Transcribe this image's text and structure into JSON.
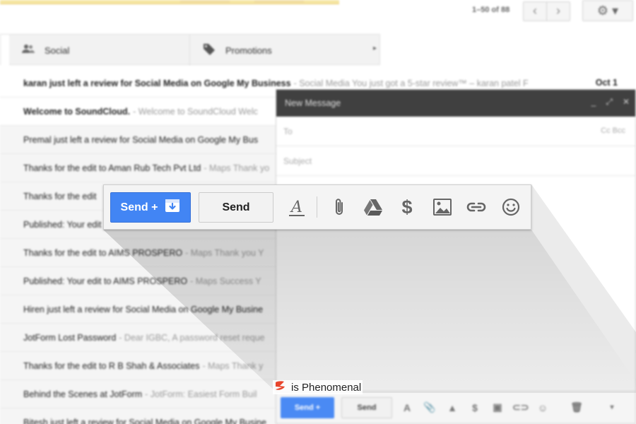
{
  "pager": {
    "text": "1–50 of 88",
    "prev": "‹",
    "next": "›",
    "settings": "⚙ ▾"
  },
  "tabs": [
    {
      "label": "Social",
      "icon": "people-icon"
    },
    {
      "label": "Promotions",
      "icon": "tag-icon"
    }
  ],
  "tabs_more": "▸",
  "emails": [
    {
      "subject": "karan just left a review for Social Media on Google My Business",
      "snippet": "- Social Media You just got a 5-star review™ – karan patel F",
      "date": "Oct 1",
      "unread": true
    },
    {
      "subject": "Welcome to SoundCloud.",
      "snippet": "- Welcome to SoundCloud Welc",
      "date": "",
      "unread": true
    },
    {
      "subject": "Premal just left a review for Social Media on Google My Bus",
      "snippet": "",
      "date": "",
      "unread": false
    },
    {
      "subject": "Thanks for the edit to Aman Rub Tech Pvt Ltd",
      "snippet": "- Maps Thank yo",
      "date": "",
      "unread": false
    },
    {
      "subject": "Thanks for the edit",
      "snippet": "",
      "date": "",
      "unread": false
    },
    {
      "subject": "Published: Your edit",
      "snippet": "",
      "date": "",
      "unread": false
    },
    {
      "subject": "Thanks for the edit to AIMS PROSPERO",
      "snippet": "- Maps Thank you Y",
      "date": "",
      "unread": false
    },
    {
      "subject": "Published: Your edit to AIMS PROSPERO",
      "snippet": "- Maps Success Y",
      "date": "",
      "unread": false
    },
    {
      "subject": "Hiren just left a review for Social Media on Google My Busine",
      "snippet": "",
      "date": "",
      "unread": false
    },
    {
      "subject": "JotForm Lost Password",
      "snippet": "- Dear IGBC, A password reset reque",
      "date": "",
      "unread": false
    },
    {
      "subject": "Thanks for the edit to R B Shah & Associates",
      "snippet": "- Maps Thank y",
      "date": "",
      "unread": false
    },
    {
      "subject": "Behind the Scenes at JotForm",
      "snippet": "- JotForm: Easiest Form Buil",
      "date": "",
      "unread": false
    },
    {
      "subject": "Bitesh just left a review for Social Media on Google My Busine",
      "snippet": "",
      "date": "",
      "unread": false
    }
  ],
  "compose": {
    "title": "New Message",
    "header_icons": [
      "_",
      "⤢",
      "✕"
    ],
    "to_placeholder": "To",
    "cc_bcc": "Cc  Bcc",
    "subject_placeholder": "Subject",
    "mini_send_plus": "Send +",
    "mini_send": "Send",
    "mini_icons": [
      "A",
      "📎",
      "▲",
      "$",
      "▣",
      "⊂⊃",
      "☺"
    ],
    "mini_trash": "🗑",
    "mini_more": "▾"
  },
  "toolbar": {
    "send_plus_label": "Send +",
    "send_label": "Send",
    "format_label": "A",
    "dollar_label": "$",
    "icons": [
      "text-format-icon",
      "paperclip-icon",
      "google-drive-icon",
      "dollar-icon",
      "insert-photo-icon",
      "link-icon",
      "emoji-icon"
    ]
  },
  "caption": {
    "text": "is Phenomenal"
  },
  "colors": {
    "send_blue": "#4285f4",
    "compose_header": "#404040",
    "logo_red": "#e8452c"
  }
}
